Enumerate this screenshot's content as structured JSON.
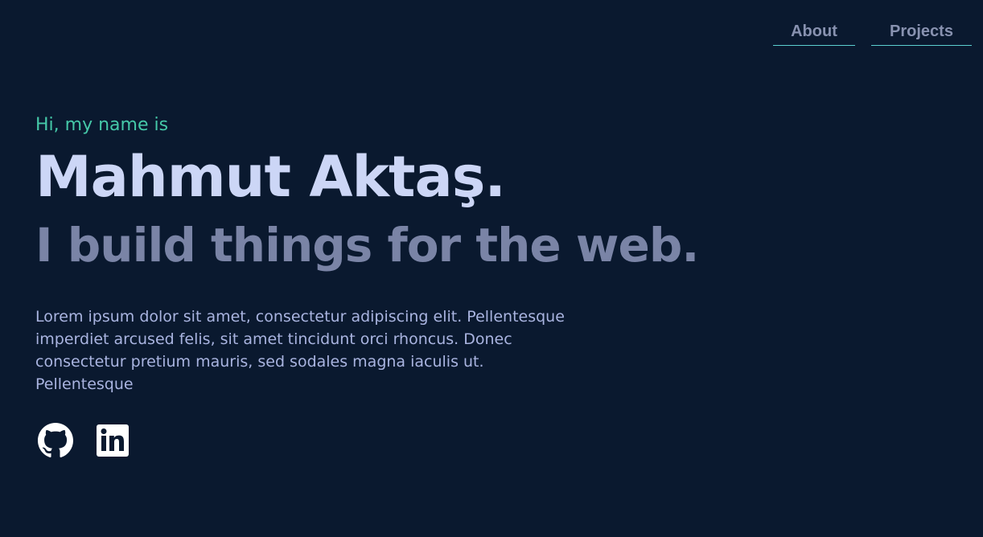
{
  "nav": {
    "items": [
      {
        "label": "About"
      },
      {
        "label": "Projects"
      }
    ]
  },
  "hero": {
    "greeting": "Hi, my name is",
    "name": "Mahmut Aktaş.",
    "tagline": "I build things for the web.",
    "description": "Lorem ipsum dolor sit amet, consectetur adipiscing elit. Pellentesque imperdiet arcused felis, sit amet tincidunt orci rhoncus. Donec consectetur pretium mauris, sed sodales magna iaculis ut. Pellentesque"
  },
  "socials": [
    {
      "icon": "github-icon"
    },
    {
      "icon": "linkedin-icon"
    }
  ],
  "colors": {
    "background": "#0a192f",
    "accent": "#45c8a8",
    "heading": "#ccd6f6",
    "muted": "#8892b0"
  }
}
